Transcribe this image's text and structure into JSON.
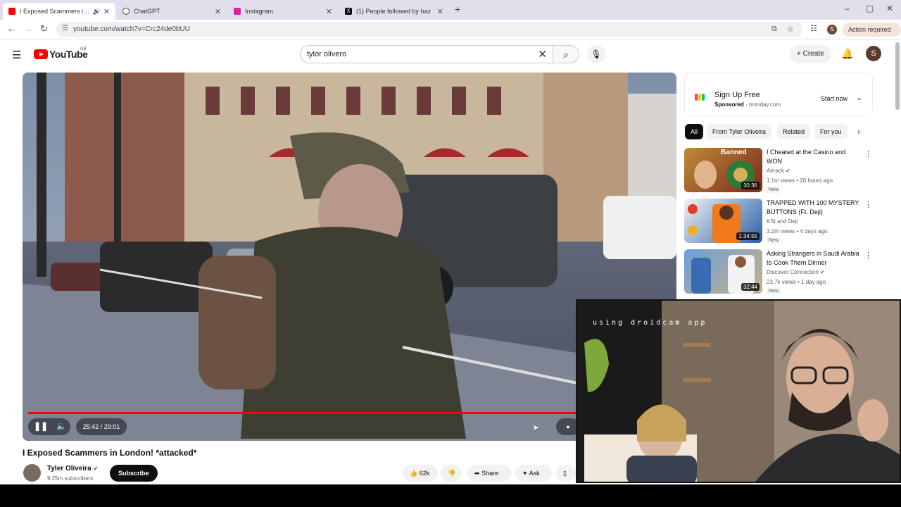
{
  "browser": {
    "tabs": [
      {
        "title": "I Exposed Scammers in London",
        "favicon_color": "#ff0000",
        "active": true
      },
      {
        "title": "ChatGPT",
        "favicon_color": "#444444",
        "active": false
      },
      {
        "title": "Instagram",
        "favicon_color": "#d6249f",
        "active": false
      },
      {
        "title": "(1) People followed by haz",
        "favicon_color": "#000000",
        "active": false
      }
    ],
    "url": "youtube.com/watch?v=Crc24de0bUU",
    "action_required": "Action required",
    "profile_initial": "S"
  },
  "youtube": {
    "logo_text": "YouTube",
    "region": "GB",
    "search_query": "tylor olivero",
    "create_label": "Create",
    "avatar_initial": "S"
  },
  "player": {
    "progress": 0.886,
    "time": "25:42 / 29:01"
  },
  "video": {
    "title": "I Exposed Scammers in London! *attacked*",
    "channel": "Tyler Oliveira",
    "subscribers": "9.25m subscribers",
    "subscribe_label": "Subscribe",
    "likes": "62k",
    "share_label": "Share",
    "ask_label": "Ask"
  },
  "ad": {
    "title": "Sign Up Free",
    "sponsored": "Sponsored",
    "domain": "monday.com",
    "cta": "Start now"
  },
  "chips": [
    "All",
    "From Tyler Oliveira",
    "Related",
    "For you"
  ],
  "recommendations": [
    {
      "title": "I Cheated at the Casino and WON",
      "channel": "Airrack",
      "meta": "1.1m views • 20 hours ago",
      "badge": "New",
      "duration": "30:36",
      "overlay_text": "Banned"
    },
    {
      "title": "TRAPPED WITH 100 MYSTERY BUTTONS (Ft. Deji)",
      "channel": "KSI and Deji",
      "meta": "3.2m views • 4 days ago",
      "badge": "New",
      "duration": "1:34:55",
      "overlay_text": ""
    },
    {
      "title": "Asking Strangers in Saudi Arabia to Cook Them Dinner",
      "channel": "Discover Connection",
      "meta": "23.7k views • 1 day ago",
      "badge": "New",
      "duration": "32:44",
      "overlay_text": ""
    }
  ],
  "overlay": {
    "caption": "using droidcam app"
  }
}
